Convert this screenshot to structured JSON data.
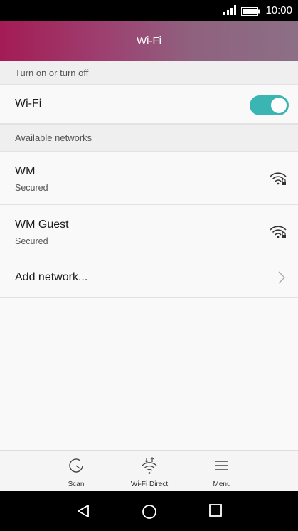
{
  "status_bar": {
    "time": "10:00",
    "signal_icon": "signal-icon",
    "battery_icon": "battery-icon"
  },
  "header": {
    "title": "Wi-Fi"
  },
  "sections": {
    "toggle_header": "Turn on or turn off",
    "networks_header": "Available networks"
  },
  "wifi_toggle": {
    "label": "Wi-Fi",
    "state": "on",
    "accent_color": "#3bb5b3"
  },
  "networks": [
    {
      "name": "WM",
      "security": "Secured",
      "icon": "wifi-secured-icon"
    },
    {
      "name": "WM Guest",
      "security": "Secured",
      "icon": "wifi-secured-icon"
    }
  ],
  "add_network": {
    "label": "Add network..."
  },
  "bottom_actions": [
    {
      "label": "Scan",
      "icon": "scan-icon"
    },
    {
      "label": "Wi-Fi Direct",
      "icon": "wifi-direct-icon"
    },
    {
      "label": "Menu",
      "icon": "menu-icon"
    }
  ],
  "nav": {
    "back": "back-icon",
    "home": "home-icon",
    "recents": "recents-icon"
  }
}
